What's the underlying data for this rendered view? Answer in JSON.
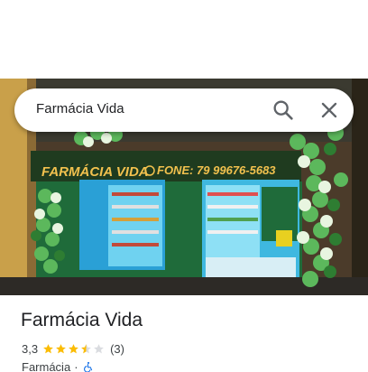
{
  "search": {
    "query": "Farmácia Vida",
    "search_icon": "search-icon",
    "close_icon": "close-icon"
  },
  "photo": {
    "sign_name": "FARMÁCIA VIDA",
    "sign_phone": "FONE: 79 99676-5683",
    "sign_icon": "whatsapp-icon"
  },
  "place": {
    "title": "Farmácia Vida",
    "rating_value": "3,3",
    "rating": 3.3,
    "review_count": "(3)",
    "category": "Farmácia",
    "separator": "·",
    "accessibility_icon": "wheelchair-icon"
  },
  "colors": {
    "star_filled": "#fbbc04",
    "star_empty": "#dadce0",
    "accessible_blue": "#1a73e8",
    "text_primary": "#202124",
    "text_secondary": "#3c4043"
  }
}
